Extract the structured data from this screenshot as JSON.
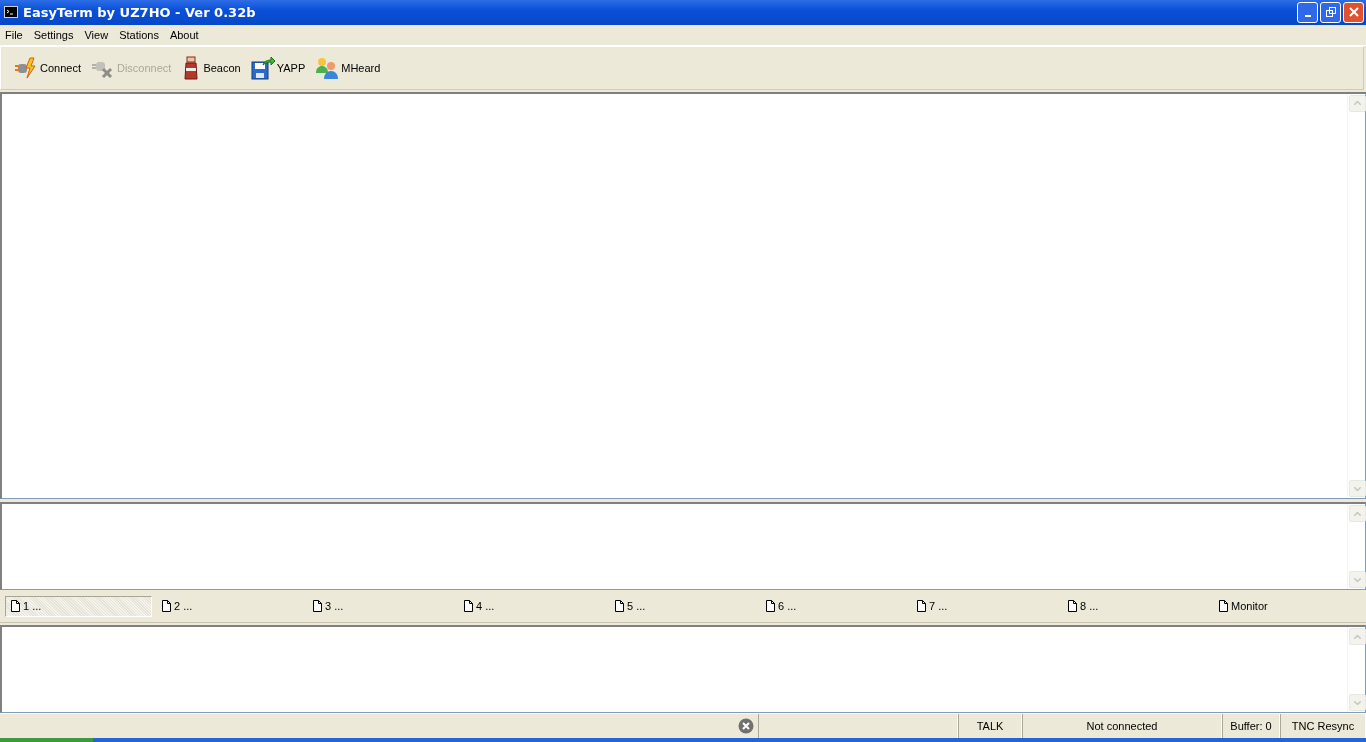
{
  "window": {
    "title": "EasyTerm by UZ7HO - Ver 0.32b"
  },
  "menu": [
    "File",
    "Settings",
    "View",
    "Stations",
    "About"
  ],
  "toolbar": [
    {
      "label": "Connect",
      "kind": "connect",
      "disabled": false
    },
    {
      "label": "Disconnect",
      "kind": "disconnect",
      "disabled": true
    },
    {
      "label": "Beacon",
      "kind": "beacon",
      "disabled": false
    },
    {
      "label": "YAPP",
      "kind": "yapp",
      "disabled": false
    },
    {
      "label": "MHeard",
      "kind": "mheard",
      "disabled": false
    }
  ],
  "channel_tabs": [
    {
      "label": "1 ...",
      "selected": true
    },
    {
      "label": "2 ...",
      "selected": false
    },
    {
      "label": "3 ...",
      "selected": false
    },
    {
      "label": "4 ...",
      "selected": false
    },
    {
      "label": "5 ...",
      "selected": false
    },
    {
      "label": "6 ...",
      "selected": false
    },
    {
      "label": "7 ...",
      "selected": false
    },
    {
      "label": "8 ...",
      "selected": false
    },
    {
      "label": "Monitor",
      "selected": false
    }
  ],
  "status_bar": [
    "TALK",
    "Not connected",
    "Buffer: 0",
    "TNC Resync"
  ]
}
